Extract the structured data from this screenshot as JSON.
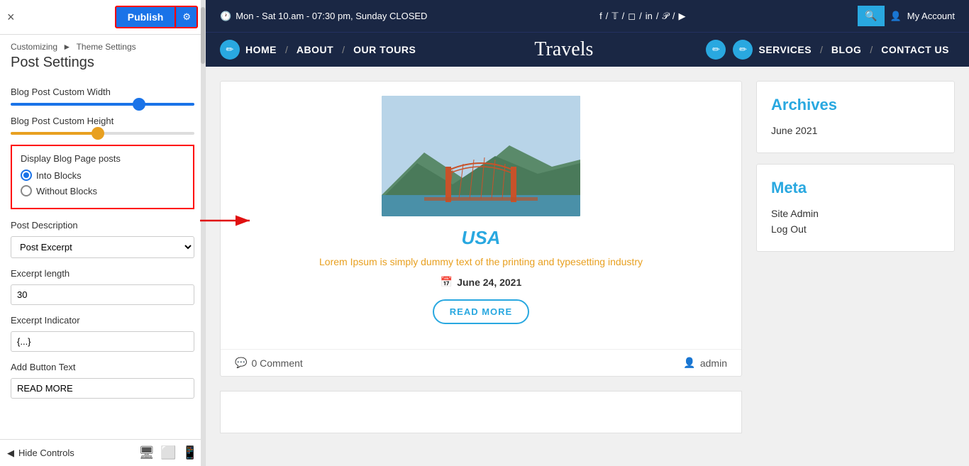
{
  "topbar": {
    "close_label": "×",
    "publish_label": "Publish",
    "settings_icon": "⚙"
  },
  "breadcrumb": {
    "customizing": "Customizing",
    "separator": "►",
    "theme_settings": "Theme Settings"
  },
  "panel": {
    "title": "Post Settings",
    "blog_custom_width_label": "Blog Post Custom Width",
    "blog_custom_height_label": "Blog Post Custom Height",
    "display_blog_label": "Display Blog Page posts",
    "radio_into_blocks": "Into Blocks",
    "radio_without_blocks": "Without Blocks",
    "post_description_label": "Post Description",
    "post_description_value": "Post Excerpt",
    "excerpt_length_label": "Excerpt length",
    "excerpt_length_value": "30",
    "excerpt_indicator_label": "Excerpt Indicator",
    "excerpt_indicator_value": "{...}",
    "add_button_label": "Add Button Text",
    "add_button_value": "READ MORE",
    "hide_controls": "Hide Controls"
  },
  "site": {
    "top_bar_text": "Mon - Sat 10.am - 07:30 pm, Sunday CLOSED",
    "my_account": "My Account",
    "nav_home": "Home",
    "nav_about": "ABOUT",
    "nav_tours": "OUR TOURS",
    "nav_logo": "Travels",
    "nav_services": "SERVICES",
    "nav_blog": "BLOG",
    "nav_contact": "CONTACT US"
  },
  "post": {
    "title": "USA",
    "excerpt": "Lorem Ipsum is simply dummy text of the printing and typesetting industry",
    "date": "June 24, 2021",
    "read_more": "READ MORE",
    "comment_count": "0 Comment",
    "author": "admin"
  },
  "sidebar": {
    "archives_title": "Archives",
    "archives_item": "June 2021",
    "meta_title": "Meta",
    "meta_site_admin": "Site Admin",
    "meta_log_out": "Log Out"
  },
  "colors": {
    "accent_blue": "#29a8e0",
    "dark_nav": "#1a2744",
    "orange": "#e8a020"
  }
}
